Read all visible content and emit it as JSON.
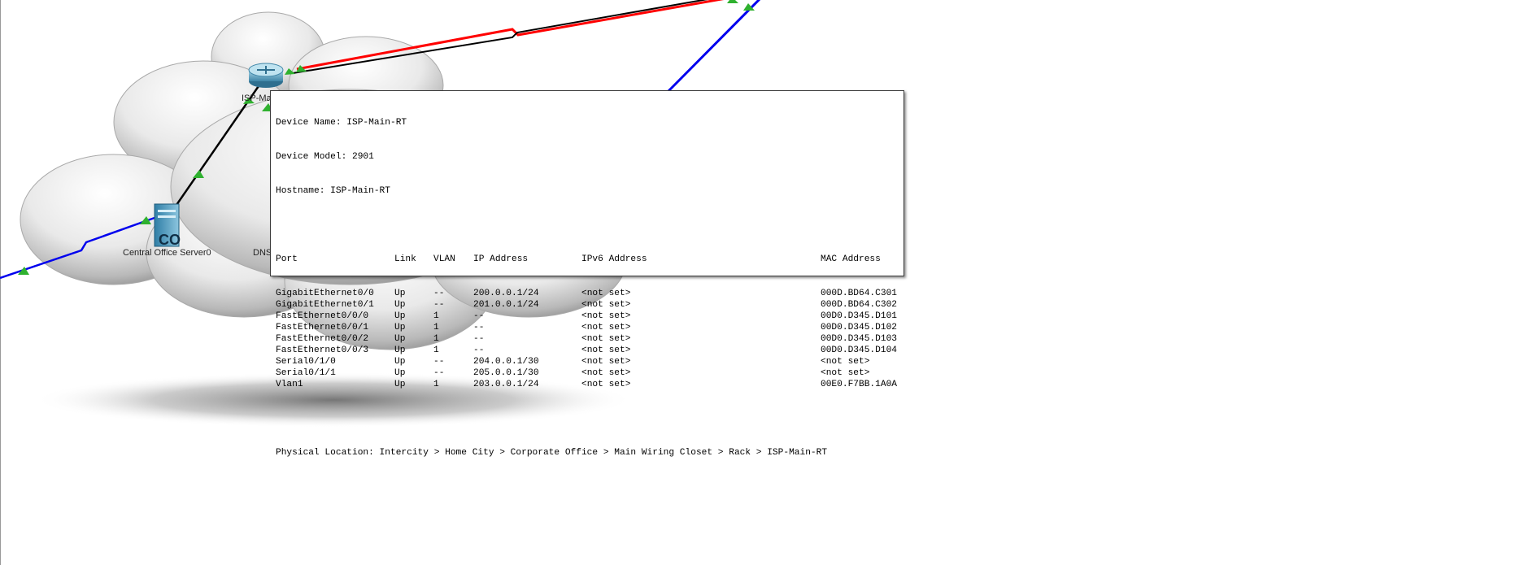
{
  "labels": {
    "central_office_server": "Central Office Server0",
    "router_partial": "ISP-Ma",
    "dns_partial": "DNS"
  },
  "tooltip": {
    "device_name": "Device Name: ISP-Main-RT",
    "device_model": "Device Model: 2901",
    "hostname": "Hostname: ISP-Main-RT",
    "headers": {
      "port": "Port",
      "link": "Link",
      "vlan": "VLAN",
      "ip": "IP Address",
      "ipv6": "IPv6 Address",
      "mac": "MAC Address"
    },
    "rows": [
      {
        "port": "GigabitEthernet0/0",
        "link": "Up",
        "vlan": "--",
        "ip": "200.0.0.1/24",
        "ipv6": "<not set>",
        "mac": "000D.BD64.C301"
      },
      {
        "port": "GigabitEthernet0/1",
        "link": "Up",
        "vlan": "--",
        "ip": "201.0.0.1/24",
        "ipv6": "<not set>",
        "mac": "000D.BD64.C302"
      },
      {
        "port": "FastEthernet0/0/0",
        "link": "Up",
        "vlan": "1",
        "ip": "--",
        "ipv6": "<not set>",
        "mac": "00D0.D345.D101"
      },
      {
        "port": "FastEthernet0/0/1",
        "link": "Up",
        "vlan": "1",
        "ip": "--",
        "ipv6": "<not set>",
        "mac": "00D0.D345.D102"
      },
      {
        "port": "FastEthernet0/0/2",
        "link": "Up",
        "vlan": "1",
        "ip": "--",
        "ipv6": "<not set>",
        "mac": "00D0.D345.D103"
      },
      {
        "port": "FastEthernet0/0/3",
        "link": "Up",
        "vlan": "1",
        "ip": "--",
        "ipv6": "<not set>",
        "mac": "00D0.D345.D104"
      },
      {
        "port": "Serial0/1/0",
        "link": "Up",
        "vlan": "--",
        "ip": "204.0.0.1/30",
        "ipv6": "<not set>",
        "mac": "<not set>"
      },
      {
        "port": "Serial0/1/1",
        "link": "Up",
        "vlan": "--",
        "ip": "205.0.0.1/30",
        "ipv6": "<not set>",
        "mac": "<not set>"
      },
      {
        "port": "Vlan1",
        "link": "Up",
        "vlan": "1",
        "ip": "203.0.0.1/24",
        "ipv6": "<not set>",
        "mac": "00E0.F7BB.1A0A"
      }
    ],
    "physical_location": "Physical Location: Intercity > Home City > Corporate Office > Main Wiring Closet > Rack > ISP-Main-RT"
  },
  "colors": {
    "cable_black": "#000000",
    "cable_red": "#ff0000",
    "cable_blue": "#0000ee",
    "link_indicator": "#2fb12f"
  }
}
